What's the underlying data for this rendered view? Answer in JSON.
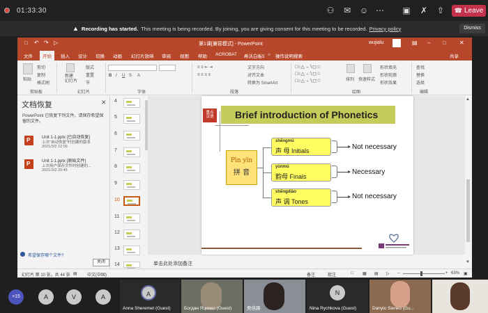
{
  "teams": {
    "timer": "01:33:30",
    "leave_label": "Leave",
    "banner_bold": "Recording has started.",
    "banner_text": "This meeting is being recorded. By joining, you are giving consent for this meeting to be recorded.",
    "privacy_link": "Privacy policy",
    "dismiss_label": "Dismiss"
  },
  "ppt": {
    "window_title": "第1课[兼容模式] - PowerPoint",
    "user": "wujialu",
    "tabs": [
      "文件",
      "开始",
      "插入",
      "设计",
      "切换",
      "动画",
      "幻灯片放映",
      "审阅",
      "视图",
      "帮助",
      "ACROBAT",
      "希沃白板5",
      "操作说明搜索"
    ],
    "active_tab": "开始",
    "share_label": "共享",
    "ribbon": {
      "paste": "粘贴",
      "cut": "剪切",
      "copy": "复制",
      "format_painter": "格式刷",
      "new_slide": "新建\n幻灯片",
      "layout": "版式",
      "reset": "重置",
      "section": "节",
      "text_direction": "文字方向",
      "align_text": "对齐文本",
      "convert_smartart": "转换为 SmartArt",
      "arrange": "排列",
      "quick_styles": "快速样式",
      "shape_fill": "形状填充",
      "shape_outline": "形状轮廓",
      "shape_effects": "形状效果",
      "find": "查找",
      "replace": "替换",
      "select": "选择",
      "groups": [
        "剪贴板",
        "幻灯片",
        "字体",
        "段落",
        "绘图",
        "编辑"
      ]
    },
    "recovery": {
      "title": "文档恢复",
      "desc": "PowerPoint 已恢复下列文件。请保存希望保留的文件。",
      "files": [
        {
          "name": "Unit 1-1.pptx [已自动恢复]",
          "note": "上次\"自动恢复\"时创建的版本",
          "date": "2021/3/2 22:09"
        },
        {
          "name": "Unit 1-1.pptx [原始文件]",
          "note": "上次用户保存文件时创建的...",
          "date": "2021/3/2 20:45"
        }
      ],
      "help": "希望保存哪个文件?",
      "close_label": "关闭"
    },
    "thumbnails": [
      "4",
      "5",
      "6",
      "7",
      "8",
      "9",
      "10",
      "11",
      "12",
      "13",
      "14"
    ],
    "active_thumb": "10",
    "notes_placeholder": "单击此处添加备注",
    "status": {
      "slide_info": "幻灯片 第 10 张，共 44 张",
      "language": "中文(中国)",
      "notes_btn": "备注",
      "comments_btn": "批注",
      "zoom": "63%"
    }
  },
  "slide": {
    "badge": "重点\n汉语",
    "title": "Brief introduction of Phonetics",
    "pinyin_py": "Pīn yīn",
    "pinyin_cn": "拼 音",
    "categories": [
      {
        "py": "shēngmǔ",
        "label": "声 母  Initials",
        "result": "Not necessary"
      },
      {
        "py": "yùnmǔ",
        "label": "韵母  Finals",
        "result": "Necessary"
      },
      {
        "py": "shēngdiào",
        "label": "声   调   Tones",
        "result": "Not necessary"
      }
    ]
  },
  "participants": {
    "more": "+15",
    "initials": [
      "A",
      "V",
      "A"
    ],
    "tiles": [
      {
        "initial": "A",
        "name": "Anna Sheremet (Guest)"
      },
      {
        "name": "Богдан Яценко (Guest)"
      },
      {
        "name": "吴佳路"
      },
      {
        "initial": "N",
        "name": "Nina Rychkova (Guest)"
      },
      {
        "name": "Danylo Sienko (Gu..."
      }
    ]
  }
}
